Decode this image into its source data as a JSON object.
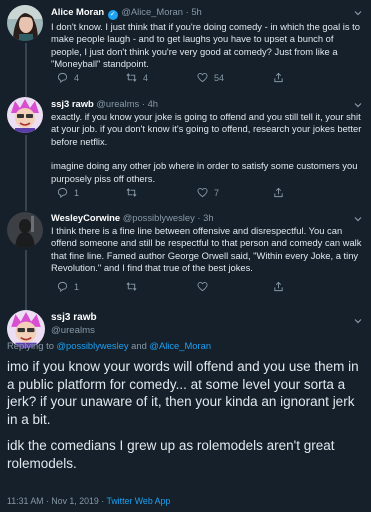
{
  "tweets": [
    {
      "name": "Alice Moran",
      "verified": true,
      "handle": "@Alice_Moran",
      "sep": "·",
      "time": "5h",
      "text": "I don't know. I just think that if you're doing comedy - in which the goal is to make people laugh - and to get laughs you have to upset a bunch of people, I just don't think you're very good at comedy? Just from like a \"Moneyball\" standpoint.",
      "reply_count": "4",
      "retweet_count": "4",
      "like_count": "54"
    },
    {
      "name": "ssj3 rawb",
      "handle": "@urealms",
      "sep": "·",
      "time": "4h",
      "text1": "exactly. if you know your joke is going to offend and you still tell it, your shit at your job. if you don't know it's going to offend, research your jokes better before netflix.",
      "text2": "imagine doing any other job where in order to satisfy some customers you purposely piss off others.",
      "reply_count": "1",
      "retweet_count": "",
      "like_count": "7"
    },
    {
      "name": "WesleyCorwine",
      "handle": "@possiblywesley",
      "sep": "·",
      "time": "3h",
      "text": "I think there is a fine line between offensive and disrespectful. You can offend someone and still be respectful to that person and comedy can walk that fine line. Famed author George Orwell said, \"Within every Joke, a tiny Revolution.\" and I find that true of the best jokes.",
      "reply_count": "1",
      "retweet_count": "",
      "like_count": ""
    }
  ],
  "focused": {
    "name": "ssj3 rawb",
    "handle": "@urealms",
    "reply_prefix": "Replying to ",
    "reply_user1": "@possiblywesley",
    "reply_and": " and ",
    "reply_user2": "@Alice_Moran",
    "text1": "imo if you know your words will offend and you use them in a public platform for comedy... at some level your sorta a jerk? if your unaware of it, then your kinda an ignorant jerk in a bit.",
    "text2": "idk the comedians I grew up as rolemodels aren't great rolemodels.",
    "timestamp": "11:31 AM · Nov 1, 2019 · ",
    "source": "Twitter Web App"
  },
  "colors": {
    "background": "#15202b",
    "text": "#e1e8ed",
    "muted": "#8899a6",
    "link": "#1da1f2",
    "divider": "#38444d"
  },
  "icons": [
    "reply-icon",
    "retweet-icon",
    "like-icon",
    "share-icon",
    "chevron-down-icon",
    "verified-badge-icon"
  ]
}
